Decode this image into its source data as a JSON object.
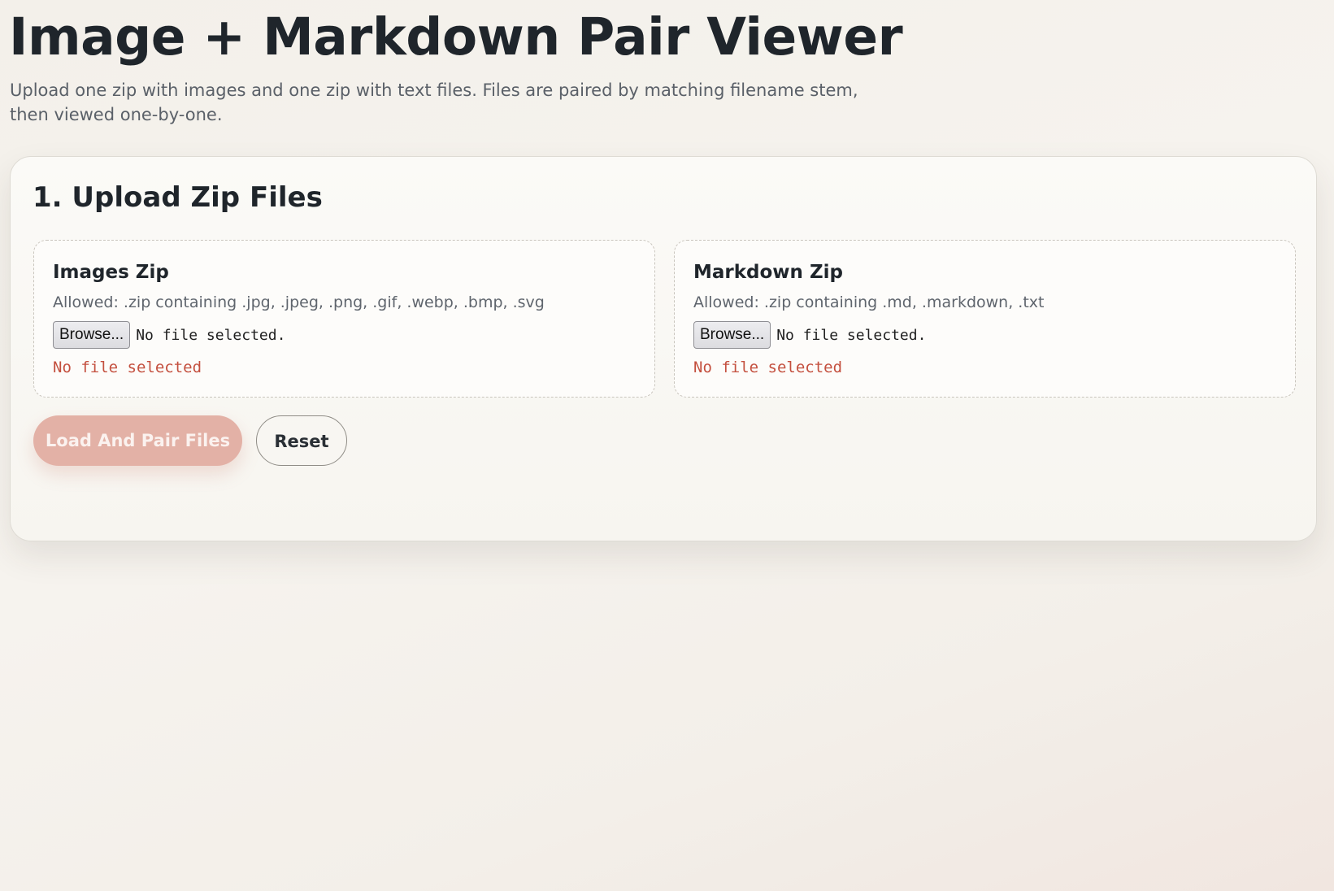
{
  "header": {
    "title": "Image + Markdown Pair Viewer",
    "subtitle": "Upload one zip with images and one zip with text files. Files are paired by matching filename stem, then viewed one-by-one."
  },
  "upload_section": {
    "title": "1. Upload Zip Files",
    "images": {
      "title": "Images Zip",
      "hint": "Allowed: .zip containing .jpg, .jpeg, .png, .gif, .webp, .bmp, .svg",
      "browse_label": "Browse...",
      "file_name": "No file selected.",
      "status": "No file selected"
    },
    "markdown": {
      "title": "Markdown Zip",
      "hint": "Allowed: .zip containing .md, .markdown, .txt",
      "browse_label": "Browse...",
      "file_name": "No file selected.",
      "status": "No file selected"
    },
    "actions": {
      "load_label": "Load And Pair Files",
      "reset_label": "Reset"
    }
  },
  "colors": {
    "primary_button_disabled": "#e3b1a6",
    "error_text": "#c4503f",
    "title_text": "#1f252b",
    "muted_text": "#5a6068"
  }
}
